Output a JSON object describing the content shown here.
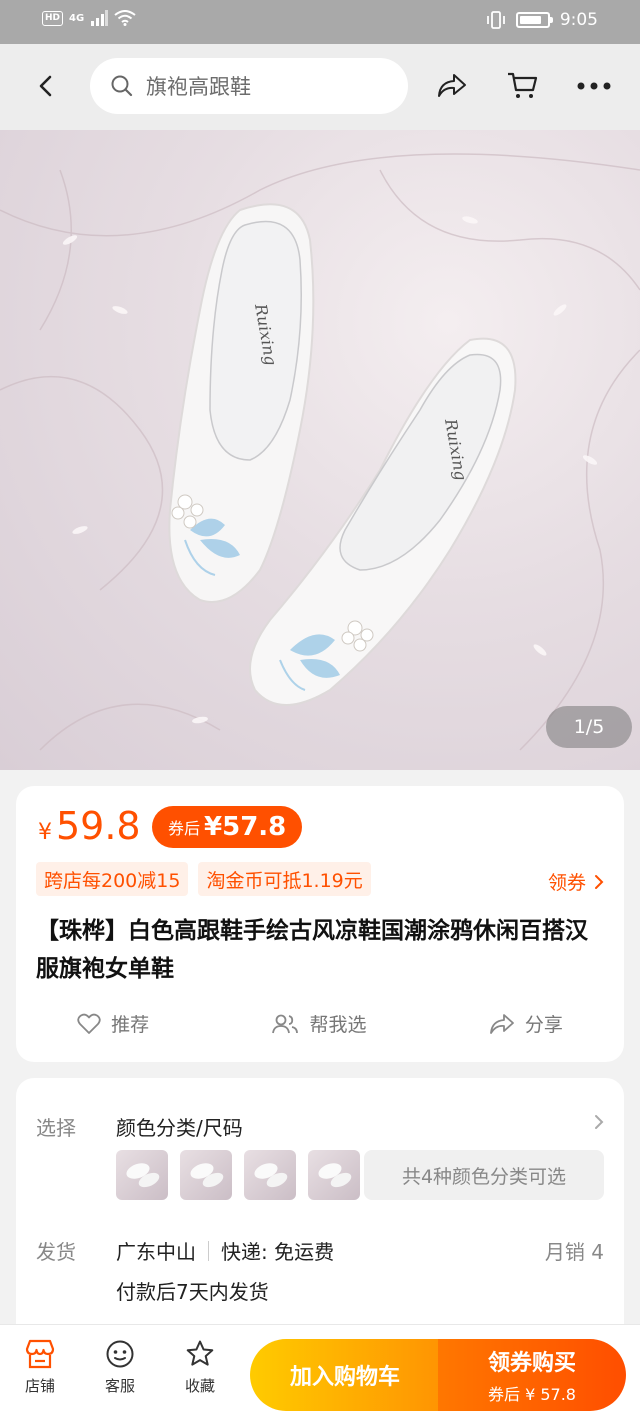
{
  "status_bar": {
    "network": "4G",
    "time": "9:05"
  },
  "search": {
    "placeholder": "旗袍高跟鞋"
  },
  "hero": {
    "counter": "1/5"
  },
  "price": {
    "currency": "¥",
    "amount": "59.8",
    "coupon_label": "券后",
    "coupon_amount": "¥57.8"
  },
  "promos": [
    "跨店每200减15",
    "淘金币可抵1.19元"
  ],
  "claim_coupon": "领券",
  "product_title": "【珠桦】白色高跟鞋手绘古风凉鞋国潮涂鸦休闲百搭汉服旗袍女单鞋",
  "actions": {
    "recommend": "推荐",
    "help_choose": "帮我选",
    "share": "分享"
  },
  "sku": {
    "select_label": "选择",
    "select_value": "颜色分类/尺码",
    "variants_note": "共4种颜色分类可选"
  },
  "shipping": {
    "label": "发货",
    "origin": "广东中山",
    "express": "快递: 免运费",
    "monthly_sales": "月销 4",
    "ship_time": "付款后7天内发货"
  },
  "bottom_bar": {
    "store": "店铺",
    "service": "客服",
    "favorite": "收藏",
    "add_to_cart": "加入购物车",
    "buy_main": "领券购买",
    "buy_sub": "券后 ¥ 57.8"
  },
  "colors": {
    "accent": "#ff5000",
    "cart_btn": "#ffb000",
    "buy_btn": "#ff5a00"
  }
}
